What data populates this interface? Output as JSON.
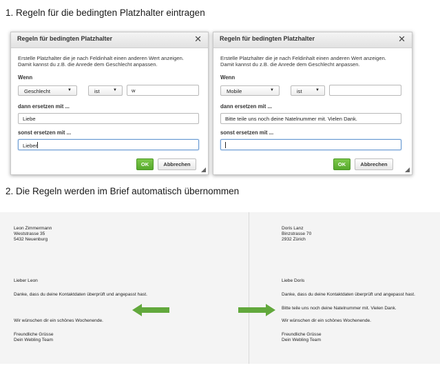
{
  "step1_heading": "1. Regeln für die bedingten Platzhalter eintragen",
  "step2_heading": "2. Die Regeln werden im Brief automatisch übernommen",
  "colors": {
    "ok_green": "#5cb531",
    "arrow_green": "#62a83c",
    "focus_blue": "#6b9bd2"
  },
  "dialog_left": {
    "title": "Regeln für bedingten Platzhalter",
    "close_icon": "close-icon",
    "description_line1": "Erstelle Platzhalter die je nach Feldinhalt einen anderen Wert anzeigen.",
    "description_line2": "Damit kannst du z.B. die Anrede dem Geschlecht anpassen.",
    "wenn_label": "Wenn",
    "field_select": "Geschlecht",
    "operator_select": "ist",
    "value_input": "w",
    "dann_label": "dann ersetzen mit ...",
    "dann_input": "Liebe",
    "sonst_label": "sonst ersetzen mit ...",
    "sonst_input": "Lieber",
    "ok_button": "OK",
    "cancel_button": "Abbrechen"
  },
  "dialog_right": {
    "title": "Regeln für bedingten Platzhalter",
    "close_icon": "close-icon",
    "description_line1": "Erstelle Platzhalter die je nach Feldinhalt einen anderen Wert anzeigen.",
    "description_line2": "Damit kannst du z.B. die Anrede dem Geschlecht anpassen.",
    "wenn_label": "Wenn",
    "field_select": "Mobile",
    "operator_select": "ist",
    "value_input": "",
    "dann_label": "dann ersetzen mit ...",
    "dann_input": "Bitte teile uns noch deine Natelnummer mit. Vielen Dank.",
    "sonst_label": "sonst ersetzen mit ...",
    "sonst_input": "",
    "ok_button": "OK",
    "cancel_button": "Abbrechen"
  },
  "letter_left": {
    "name": "Leon Zimmermann",
    "street": "Weststrasse 35",
    "city": "5432 Neuenburg",
    "salutation": "Lieber  Leon",
    "body1": "Danke, dass du deine Kontaktdaten überprüft und angepasst hast.",
    "closing": "Wir wünschen dir ein schönes Wochenende.",
    "greeting": "Freundliche Grüsse",
    "signature": "Dein Webling Team"
  },
  "letter_right": {
    "name": "Doris Lanz",
    "street": "Binzstrasse 70",
    "city": "2932 Zürich",
    "salutation": "Liebe  Doris",
    "body1": "Danke, dass du deine Kontaktdaten überprüft und angepasst hast.",
    "body2": "Bitte teile uns noch deine Natelnummer mit. Vielen Dank.",
    "closing": "Wir wünschen dir ein schönes Wochenende.",
    "greeting": "Freundliche Grüsse",
    "signature": "Dein Webling Team"
  }
}
